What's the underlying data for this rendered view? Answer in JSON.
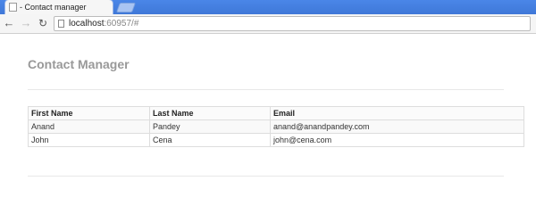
{
  "browser": {
    "tab_title": "- Contact manager",
    "url_host": "localhost",
    "url_rest": ":60957/#",
    "nav": {
      "back": "←",
      "forward": "→",
      "reload": "↻"
    }
  },
  "page": {
    "title": "Contact Manager"
  },
  "table": {
    "headers": [
      "First Name",
      "Last Name",
      "Email"
    ],
    "rows": [
      [
        "Anand",
        "Pandey",
        "anand@anandpandey.com"
      ],
      [
        "John",
        "Cena",
        "john@cena.com"
      ]
    ]
  }
}
